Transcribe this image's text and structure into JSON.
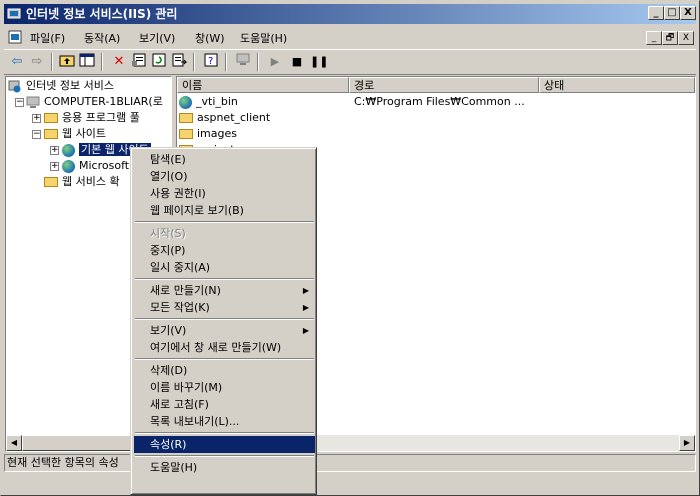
{
  "window": {
    "title": "인터넷 정보 서비스(IIS) 관리",
    "caption_buttons": {
      "minimize": "_",
      "maximize": "□",
      "close": "X"
    }
  },
  "menubar": {
    "items": [
      "파일(F)",
      "동작(A)",
      "보기(V)",
      "창(W)",
      "도움말(H)"
    ],
    "mdi_buttons": [
      "_",
      "🗗",
      "X"
    ]
  },
  "toolbar": {
    "buttons": [
      "back-icon",
      "forward-icon",
      "up-folder-icon",
      "show-hide-tree-icon",
      "delete-icon",
      "properties-icon",
      "refresh-icon",
      "export-list-icon",
      "help-icon",
      "computer-icon",
      "play-icon",
      "stop-icon",
      "pause-icon"
    ]
  },
  "tree": {
    "root": "인터넷 정보 서비스",
    "computer": "COMPUTER-1BLIAR(로",
    "app_pools": "응용 프로그램 풀",
    "web_sites": "웹 사이트",
    "default_site": "기본 웹 사이트",
    "microsoft": "Microsoft",
    "web_service_ext": "웹 서비스 확"
  },
  "list": {
    "columns": [
      "이름",
      "경로",
      "상태"
    ],
    "rows": [
      {
        "name": "_vti_bin",
        "path": "C:₩Program Files₩Common ...",
        "status": "",
        "icon": "globe"
      },
      {
        "name": "aspnet_client",
        "path": "",
        "status": "",
        "icon": "folder"
      },
      {
        "name": "images",
        "path": "",
        "status": "",
        "icon": "folder"
      },
      {
        "name": "_private",
        "path": "",
        "status": "",
        "icon": "folder"
      }
    ]
  },
  "status_text": "현재 선택한 항목의 속성",
  "context_menu": {
    "items": [
      {
        "label": "탐색(E)"
      },
      {
        "label": "열기(O)"
      },
      {
        "label": "사용 권한(I)"
      },
      {
        "label": "웹 페이지로 보기(B)"
      },
      {
        "sep": true
      },
      {
        "label": "시작(S)",
        "disabled": true
      },
      {
        "label": "중지(P)"
      },
      {
        "label": "일시 중지(A)"
      },
      {
        "sep": true
      },
      {
        "label": "새로 만들기(N)",
        "submenu": true
      },
      {
        "label": "모든 작업(K)",
        "submenu": true
      },
      {
        "sep": true
      },
      {
        "label": "보기(V)",
        "submenu": true
      },
      {
        "label": "여기에서 창 새로 만들기(W)"
      },
      {
        "sep": true
      },
      {
        "label": "삭제(D)"
      },
      {
        "label": "이름 바꾸기(M)"
      },
      {
        "label": "새로 고침(F)"
      },
      {
        "label": "목록 내보내기(L)..."
      },
      {
        "sep": true
      },
      {
        "label": "속성(R)",
        "selected": true
      },
      {
        "sep": true
      },
      {
        "label": "도움말(H)"
      }
    ]
  },
  "colors": {
    "title_start": "#0a246a",
    "title_end": "#a6caf0",
    "selection": "#0a246a",
    "face": "#d4d0c8"
  }
}
